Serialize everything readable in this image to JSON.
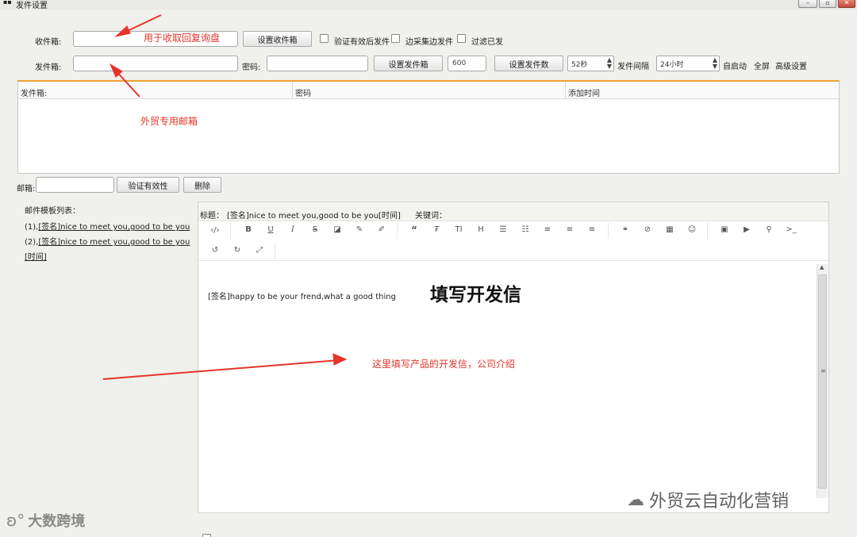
{
  "window": {
    "title": "发件设置",
    "title_prefix": "▪▪",
    "minimize": "–",
    "restore": "▫",
    "close": "✕"
  },
  "row1": {
    "inbox_label": "收件箱:",
    "set_inbox_button": "设置收件箱",
    "verify_checkbox": "验证有效后发件",
    "collect_checkbox": "边采集边发件",
    "filter_checkbox": "过滤已发"
  },
  "row2": {
    "sender_label": "发件箱:",
    "password_label": "密码:",
    "set_sender_button": "设置发件箱",
    "count_value": "600",
    "set_count_button": "设置发件数",
    "interval_seconds": "52秒",
    "interval_label": "发件间隔",
    "hours": "24小时",
    "auto_start": "自启动",
    "fullscreen": "全屏",
    "advanced": "高级设置"
  },
  "table": {
    "col_sender": "发件箱:",
    "col_password": "密码",
    "col_added_time": "添加时间"
  },
  "email_row": {
    "label": "邮箱:",
    "verify_button": "验证有效性",
    "delete_button": "删除"
  },
  "templates": {
    "heading": "邮件模板列表：",
    "items": [
      {
        "prefix": "(1),",
        "text": "[签名]nice to meet you,good to be you"
      },
      {
        "prefix": "(2),",
        "text": "[签名]nice to meet you,good to be you"
      }
    ],
    "overflow": "[时间]"
  },
  "editor": {
    "subject_label": "标题：",
    "subject_value": "[签名]nice to meet you,good to be you[时间]",
    "keywords_label": "关键词：",
    "body_text": "[签名]happy to be your frend,what a good thing"
  },
  "annotations": {
    "inbox_note": "用于收取回复询盘",
    "sender_note": "外贸专用邮箱",
    "letter_title": "填写开发信",
    "body_note": "这里填写产品的开发信，公司介绍"
  },
  "watermarks": {
    "left": "大数跨境",
    "right": "外贸云自动化营销"
  },
  "colors": {
    "accent_red": "#e6332a",
    "table_top_border": "#f0a030"
  }
}
